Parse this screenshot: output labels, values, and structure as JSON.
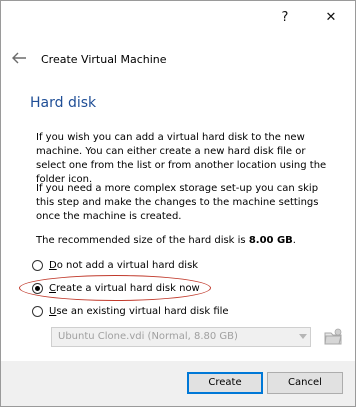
{
  "titlebar": {
    "help_label": "?",
    "close_label": "✕"
  },
  "nav": {
    "back_icon": "back-arrow-icon",
    "title": "Create Virtual Machine"
  },
  "section": {
    "title": "Hard disk"
  },
  "paragraphs": {
    "p1": "If you wish you can add a virtual hard disk to the new machine. You can either create a new hard disk file or select one from the list or from another location using the folder icon.",
    "p2": "If you need a more complex storage set-up you can skip this step and make the changes to the machine settings once the machine is created.",
    "p3_prefix": "The recommended size of the hard disk is ",
    "p3_value": "8.00 GB",
    "p3_suffix": "."
  },
  "options": [
    {
      "mnemonic": "D",
      "rest": "o not add a virtual hard disk",
      "checked": false
    },
    {
      "mnemonic": "C",
      "rest": "reate a virtual hard disk now",
      "checked": true
    },
    {
      "mnemonic": "U",
      "rest": "se an existing virtual hard disk file",
      "checked": false
    }
  ],
  "existing_disk": {
    "selected": "Ubuntu Clone.vdi (Normal, 8.80 GB)",
    "folder_icon": "folder-icon"
  },
  "buttons": {
    "create": "Create",
    "cancel": "Cancel"
  },
  "colors": {
    "heading": "#1f4e96",
    "highlight": "#c0392b",
    "primary_border": "#0078d7"
  }
}
